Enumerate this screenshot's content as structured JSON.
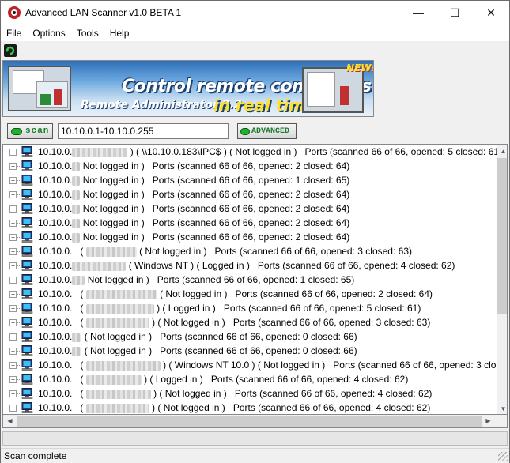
{
  "window": {
    "title": "Advanced LAN Scanner v1.0 BETA 1",
    "minimize_glyph": "—",
    "maximize_glyph": "☐",
    "close_glyph": "✕"
  },
  "menu": {
    "items": [
      "File",
      "Options",
      "Tools",
      "Help"
    ]
  },
  "toolbar": {
    "refresh_icon": "refresh-icon"
  },
  "banner": {
    "headline": "Control remote computers",
    "subtitle": "Remote Administrator 2.2",
    "tagline": "in real time!",
    "badge": "NEW!"
  },
  "scan": {
    "scan_label": "scan",
    "ip_range": "10.10.0.1-10.10.0.255",
    "advanced_label": "ADVANCED"
  },
  "results": [
    {
      "ip": "10.10.0.",
      "pre": ") ( ",
      "share": "\\\\10.10.0.183\\IPC$",
      "mid": " ) ( Not logged in )",
      "ports": "Ports (scanned 66 of 66, opened: 5 closed: 61)"
    },
    {
      "ip": "10.10.0.",
      "pre": "",
      "share": "",
      "mid": "Not logged in )",
      "ports": "Ports (scanned 66 of 66, opened: 2 closed: 64)"
    },
    {
      "ip": "10.10.0.",
      "pre": "",
      "share": "",
      "mid": "Not logged in )",
      "ports": "Ports (scanned 66 of 66, opened: 1 closed: 65)"
    },
    {
      "ip": "10.10.0.",
      "pre": "",
      "share": "",
      "mid": "Not logged in )",
      "ports": "Ports (scanned 66 of 66, opened: 2 closed: 64)"
    },
    {
      "ip": "10.10.0.",
      "pre": "",
      "share": "",
      "mid": "Not logged in )",
      "ports": "Ports (scanned 66 of 66, opened: 2 closed: 64)"
    },
    {
      "ip": "10.10.0.",
      "pre": "",
      "share": "",
      "mid": "Not logged in )",
      "ports": "Ports (scanned 66 of 66, opened: 2 closed: 64)"
    },
    {
      "ip": "10.10.0.",
      "pre": "",
      "share": "",
      "mid": "Not logged in )",
      "ports": "Ports (scanned 66 of 66, opened: 2 closed: 64)"
    },
    {
      "ip": "10.10.0.",
      "pre": "(",
      "share": "",
      "mid": "( Not logged in )",
      "ports": "Ports (scanned 66 of 66, opened: 3 closed: 63)"
    },
    {
      "ip": "10.10.0.",
      "pre": "",
      "share": "",
      "mid": "( Windows NT ) ( Logged in )",
      "ports": "Ports (scanned 66 of 66, opened: 4 closed: 62)"
    },
    {
      "ip": "10.10.0.",
      "pre": "",
      "share": "",
      "mid": "Not logged in )",
      "ports": "Ports (scanned 66 of 66, opened: 1 closed: 65)"
    },
    {
      "ip": "10.10.0.",
      "pre": "(",
      "share": "",
      "mid": "( Not logged in )",
      "ports": "Ports (scanned 66 of 66, opened: 2 closed: 64)"
    },
    {
      "ip": "10.10.0.",
      "pre": "(",
      "share": "",
      "mid": ") ( Logged in )",
      "ports": "Ports (scanned 66 of 66, opened: 5 closed: 61)"
    },
    {
      "ip": "10.10.0.",
      "pre": "(",
      "share": "",
      "mid": ") ( Not logged in )",
      "ports": "Ports (scanned 66 of 66, opened: 3 closed: 63)"
    },
    {
      "ip": "10.10.0.",
      "pre": "",
      "share": "",
      "mid": "( Not logged in )",
      "ports": "Ports (scanned 66 of 66, opened: 0 closed: 66)"
    },
    {
      "ip": "10.10.0.",
      "pre": "",
      "share": "",
      "mid": "( Not logged in )",
      "ports": "Ports (scanned 66 of 66, opened: 0 closed: 66)"
    },
    {
      "ip": "10.10.0.",
      "pre": "(",
      "share": "",
      "mid": ") ( Windows NT 10.0 ) ( Not logged in )",
      "ports": "Ports (scanned 66 of 66, opened: 3 clos"
    },
    {
      "ip": "10.10.0.",
      "pre": "(",
      "share": "",
      "mid": ") ( Logged in )",
      "ports": "Ports (scanned 66 of 66, opened: 4 closed: 62)"
    },
    {
      "ip": "10.10.0.",
      "pre": "(",
      "share": "",
      "mid": ") ( Not logged in )",
      "ports": "Ports (scanned 66 of 66, opened: 4 closed: 62)"
    },
    {
      "ip": "10.10.0.",
      "pre": "(",
      "share": "",
      "mid": ") ( Not logged in )",
      "ports": "Ports (scanned 66 of 66, opened: 4 closed: 62)"
    }
  ],
  "status": {
    "text": "Scan complete"
  },
  "colors": {
    "accent_green": "#20b030",
    "banner_blue": "#2e6fb8",
    "banner_yellow": "#ffe02a"
  }
}
